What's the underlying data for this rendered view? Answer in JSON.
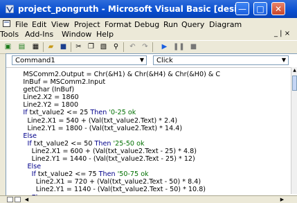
{
  "window": {
    "title": "project_pongruth - Microsoft Visual Basic [desi...",
    "minimize_glyph": "—",
    "maximize_glyph": "□",
    "close_glyph": "✕"
  },
  "menubar": {
    "row1": [
      "File",
      "Edit",
      "View",
      "Project",
      "Format",
      "Debug",
      "Run",
      "Query",
      "Diagram"
    ],
    "row2": [
      "Tools",
      "Add-Ins",
      "Window",
      "Help"
    ],
    "mdi_controls": "_ | ×"
  },
  "toolbar": {
    "icons": [
      "add-project-icon",
      "add-form-icon",
      "menu-editor-icon",
      "open-icon",
      "save-icon",
      "cut-icon",
      "copy-icon",
      "paste-icon",
      "find-icon",
      "undo-icon",
      "redo-icon",
      "start-icon",
      "break-icon",
      "end-icon"
    ]
  },
  "editor": {
    "object_combo": "Command1",
    "procedure_combo": "Click",
    "code_lines": [
      {
        "text": "        MSComm2.Output = Chr(&H1) & Chr(&H4) & Chr(&H0) & C",
        "kind": "code"
      },
      {
        "text": "        InBuf = MSComm2.Input",
        "kind": "code"
      },
      {
        "text": "        getChar (InBuf)",
        "kind": "code"
      },
      {
        "text": "        Line2.X2 = 1860",
        "kind": "code"
      },
      {
        "text": "        Line2.Y2 = 1800",
        "kind": "code"
      },
      {
        "text": "        If txt_value2 <= 25 Then '0-25 ok",
        "kind": "code"
      },
      {
        "text": "          Line2.X1 = 540 + (Val(txt_value2.Text) * 2.4)",
        "kind": "code"
      },
      {
        "text": "          Line2.Y1 = 1800 - (Val(txt_value2.Text) * 14.4)",
        "kind": "code"
      },
      {
        "text": "        Else",
        "kind": "code"
      },
      {
        "text": "          If txt_value2 <= 50 Then '25-50 ok",
        "kind": "code"
      },
      {
        "text": "            Line2.X1 = 600 + (Val(txt_value2.Text - 25) * 4.8)",
        "kind": "code"
      },
      {
        "text": "            Line2.Y1 = 1440 - (Val(txt_value2.Text - 25) * 12)",
        "kind": "code"
      },
      {
        "text": "          Else",
        "kind": "code"
      },
      {
        "text": "            If txt_value2 <= 75 Then '50-75 ok",
        "kind": "code"
      },
      {
        "text": "              Line2.X1 = 720 + (Val(txt_value2.Text - 50) * 8.4)",
        "kind": "code"
      },
      {
        "text": "              Line2.Y1 = 1140 - (Val(txt_value2.Text - 50) * 10.8)",
        "kind": "code"
      },
      {
        "text": "            Else",
        "kind": "code"
      }
    ]
  },
  "colors": {
    "titlebar": "#0a4fd0",
    "keyword": "#00008b",
    "comment": "#007000"
  }
}
